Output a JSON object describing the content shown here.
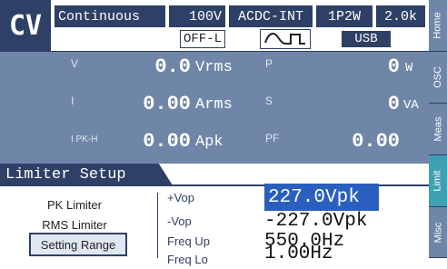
{
  "header": {
    "mode": "CV",
    "mode_detail": "Continuous",
    "voltage_range": "100V",
    "coupling": "ACDC-INT",
    "phase": "1P2W",
    "frequency_range": "2.0k",
    "output_state": "OFF-L",
    "interface": "USB",
    "waveform_icon": "sine-square-wave-icon"
  },
  "measurements": [
    {
      "label": "V",
      "value": "0.0",
      "unit": "Vrms",
      "label2": "P",
      "value2": "0",
      "unit2": "W"
    },
    {
      "label": "I",
      "value": "0.00",
      "unit": "Arms",
      "label2": "S",
      "value2": "0",
      "unit2": "VA"
    },
    {
      "label": "I PK-H",
      "value": "0.00",
      "unit": "Apk",
      "label2": "PF",
      "value2": "0.00",
      "unit2": ""
    }
  ],
  "limiter": {
    "title": "Limiter Setup",
    "menu": [
      "PK Limiter",
      "RMS Limiter",
      "Setting Range"
    ],
    "selected_menu": "Setting Range",
    "params": [
      {
        "label": "+Vop",
        "value": "227.0Vpk"
      },
      {
        "label": "-Vop",
        "value": "-227.0Vpk"
      },
      {
        "label": "Freq Up",
        "value": "550.0Hz"
      },
      {
        "label": "Freq Lo",
        "value": "1.00Hz"
      }
    ]
  },
  "side_tabs": [
    "Home",
    "OSC",
    "Meas",
    "Limit",
    "Misc"
  ],
  "active_tab": "Limit",
  "colors": {
    "navy": "#2f4066",
    "measure_bg": "#6f86a8",
    "highlight": "#2a5fbf",
    "active_tab": "#3f9fb3"
  }
}
